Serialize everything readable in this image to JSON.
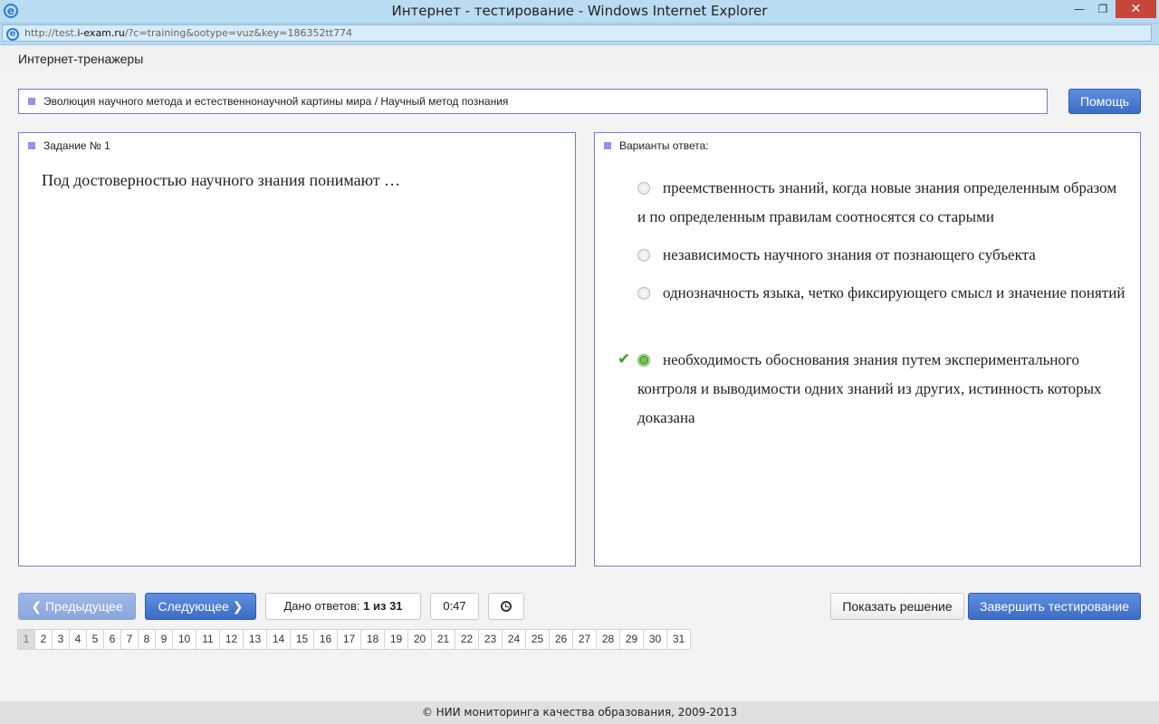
{
  "window": {
    "title": "Интернет - тестирование - Windows Internet Explorer",
    "minimize": "—",
    "maximize": "❐",
    "close": "✕"
  },
  "address": {
    "url_prefix": "http://test.",
    "url_domain": "i-exam.ru",
    "url_path": "/?c=training&ootype=vuz&key=186352tt774"
  },
  "brand": "Интернет-тренажеры",
  "topic": "Эволюция научного метода и естественнонаучной картины мира / Научный метод познания",
  "help_label": "Помощь",
  "task": {
    "heading": "Задание № 1",
    "question": "Под достоверностью научного знания понимают …"
  },
  "answers": {
    "heading": "Варианты ответа:",
    "options": [
      {
        "text": "преемственность знаний, когда новые знания определенным образом и по определенным правилам соотносятся со старыми",
        "selected": false
      },
      {
        "text": "независимость научного знания от познающего субъекта",
        "selected": false
      },
      {
        "text": "однозначность языка, четко фиксирующего смысл и значение понятий",
        "selected": false
      },
      {
        "text": "необходимость обоснования знания путем экспериментального контроля и выводимости одних знаний из других, истинность которых доказана",
        "selected": true
      }
    ]
  },
  "nav": {
    "prev_label": "Предыдущее",
    "next_label": "Следующее",
    "answered_label": "Дано ответов:",
    "answered_value": "1 из 31",
    "timer": "0:47",
    "show_solution_label": "Показать решение",
    "finish_label": "Завершить тестирование"
  },
  "pages": {
    "current": 1,
    "items": [
      "1",
      "2",
      "3",
      "4",
      "5",
      "6",
      "7",
      "8",
      "9",
      "10",
      "11",
      "12",
      "13",
      "14",
      "15",
      "16",
      "17",
      "18",
      "19",
      "20",
      "21",
      "22",
      "23",
      "24",
      "25",
      "26",
      "27",
      "28",
      "29",
      "30",
      "31"
    ]
  },
  "footer": "© НИИ мониторинга качества образования, 2009-2013",
  "colors": {
    "accent": "#3c6cc6",
    "panel_border": "#6e7ec6",
    "marker": "#9b8ef0",
    "selected": "#3a8f25"
  }
}
